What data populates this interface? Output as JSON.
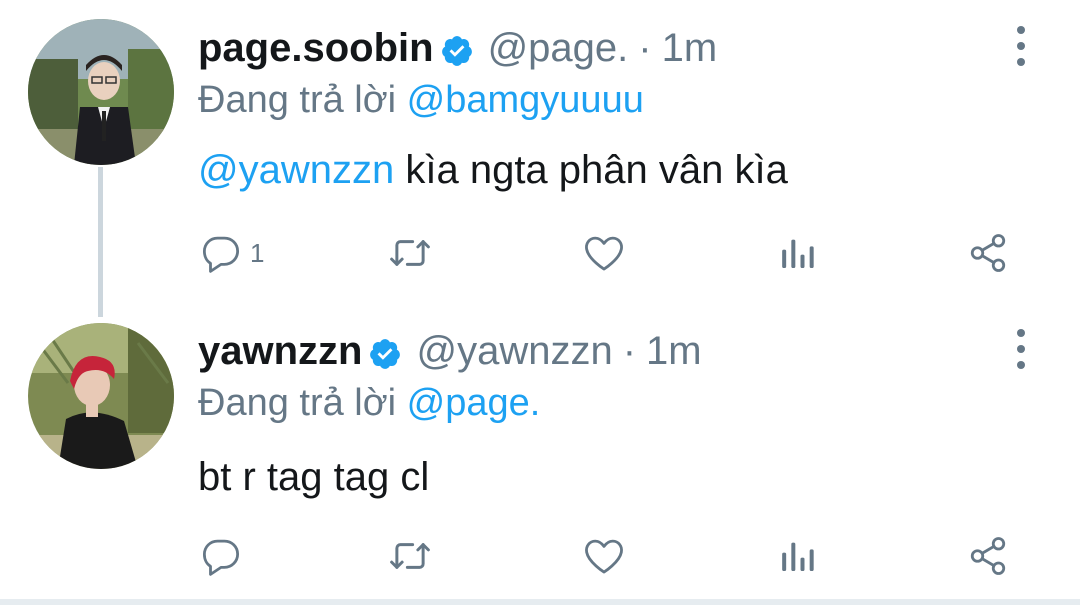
{
  "tweets": [
    {
      "display_name": "page.soobin",
      "handle": "@page.",
      "separator": "·",
      "time": "1m",
      "replying_label": "Đang trả lời",
      "replying_to": "@bamgyuuuu",
      "text_mention": "@yawnzzn",
      "text": " kìa ngta phân vân kìa",
      "reply_count": "1",
      "verified": true,
      "avatar_icon": "user-avatar-photo",
      "has_thread_line": true
    },
    {
      "display_name": "yawnzzn",
      "handle": "@yawnzzn",
      "separator": "·",
      "time": "1m",
      "replying_label": "Đang trả lời",
      "replying_to": "@page.",
      "text_mention": "",
      "text": "bt r tag tag cl",
      "reply_count": "",
      "verified": true,
      "avatar_icon": "user-avatar-photo",
      "has_thread_line": false
    }
  ],
  "icons": {
    "verified": "verified-badge-icon",
    "more": "more-vertical-icon",
    "reply": "reply-icon",
    "retweet": "retweet-icon",
    "like": "heart-icon",
    "analytics": "analytics-icon",
    "share": "share-icon"
  },
  "colors": {
    "mention": "#1da1f2",
    "verified": "#1da1f2",
    "secondary_text": "#657786",
    "primary_text": "#14171a",
    "thread_line": "#ccd6dd"
  }
}
